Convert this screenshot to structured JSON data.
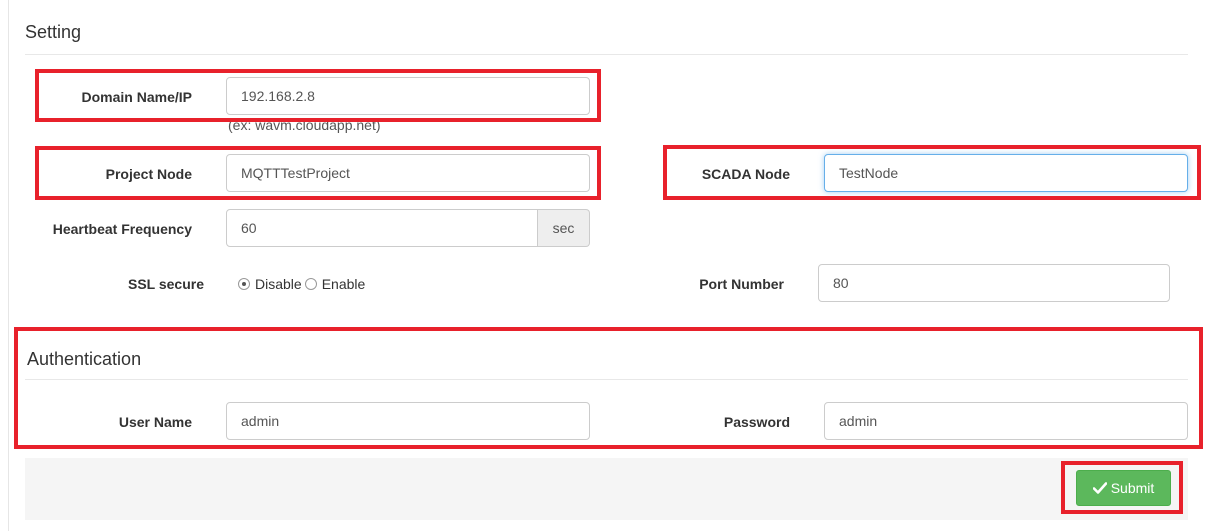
{
  "setting": {
    "title": "Setting",
    "domain": {
      "label": "Domain Name/IP",
      "value": "192.168.2.8",
      "hint": "(ex: wavm.cloudapp.net)"
    },
    "project_node": {
      "label": "Project Node",
      "value": "MQTTTestProject"
    },
    "scada_node": {
      "label": "SCADA Node",
      "value": "TestNode"
    },
    "heartbeat": {
      "label": "Heartbeat Frequency",
      "value": "60",
      "unit": "sec"
    },
    "ssl": {
      "label": "SSL secure",
      "options": [
        "Disable",
        "Enable"
      ],
      "selected": "Disable"
    },
    "port": {
      "label": "Port Number",
      "value": "80"
    }
  },
  "authentication": {
    "title": "Authentication",
    "user_name": {
      "label": "User Name",
      "value": "admin"
    },
    "password": {
      "label": "Password",
      "value": "admin"
    }
  },
  "footer": {
    "submit_label": "Submit"
  },
  "colors": {
    "highlight": "#e8212b",
    "submit": "#5cb85c",
    "focus": "#66afe9"
  }
}
